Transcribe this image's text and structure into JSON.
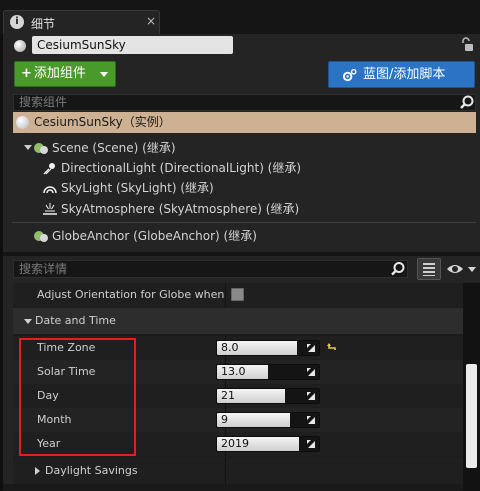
{
  "tab": {
    "title": "细节",
    "close": "×"
  },
  "actor": {
    "name": "CesiumSunSky"
  },
  "toolbar": {
    "add_component_label": "添加组件",
    "add_component_plus": "+",
    "blueprint_label": "蓝图/添加脚本"
  },
  "search_components": {
    "placeholder": "搜索组件"
  },
  "components": {
    "root": {
      "label": "CesiumSunSky（实例）"
    },
    "children": [
      {
        "label": "Scene (Scene) (继承)",
        "icon": "scene-icon"
      },
      {
        "label": "DirectionalLight (DirectionalLight) (继承)",
        "icon": "directional-light-icon"
      },
      {
        "label": "SkyLight (SkyLight) (继承)",
        "icon": "sky-light-icon"
      },
      {
        "label": "SkyAtmosphere (SkyAtmosphere) (继承)",
        "icon": "sky-atmosphere-icon"
      },
      {
        "label": "GlobeAnchor (GlobeAnchor) (继承)",
        "icon": "globe-anchor-icon"
      }
    ]
  },
  "search_details": {
    "placeholder": "搜索详情"
  },
  "details": {
    "adjust_orientation": {
      "label": "Adjust Orientation for Globe when M",
      "checked": false
    },
    "category_date_time": "Date and Time",
    "properties": [
      {
        "label": "Time Zone",
        "value": "8.0",
        "fill_fraction": 0.78
      },
      {
        "label": "Solar Time",
        "value": "13.0",
        "fill_fraction": 0.5
      },
      {
        "label": "Day",
        "value": "21",
        "fill_fraction": 0.67
      },
      {
        "label": "Month",
        "value": "9",
        "fill_fraction": 0.72
      },
      {
        "label": "Year",
        "value": "2019",
        "fill_fraction": 0.8
      }
    ],
    "category_daylight_savings": "Daylight Savings"
  },
  "colors": {
    "add_button": "#4a9a2b",
    "blueprint_button": "#2b74c4",
    "selected_row": "#ceb193",
    "highlight_box": "#e02020"
  }
}
